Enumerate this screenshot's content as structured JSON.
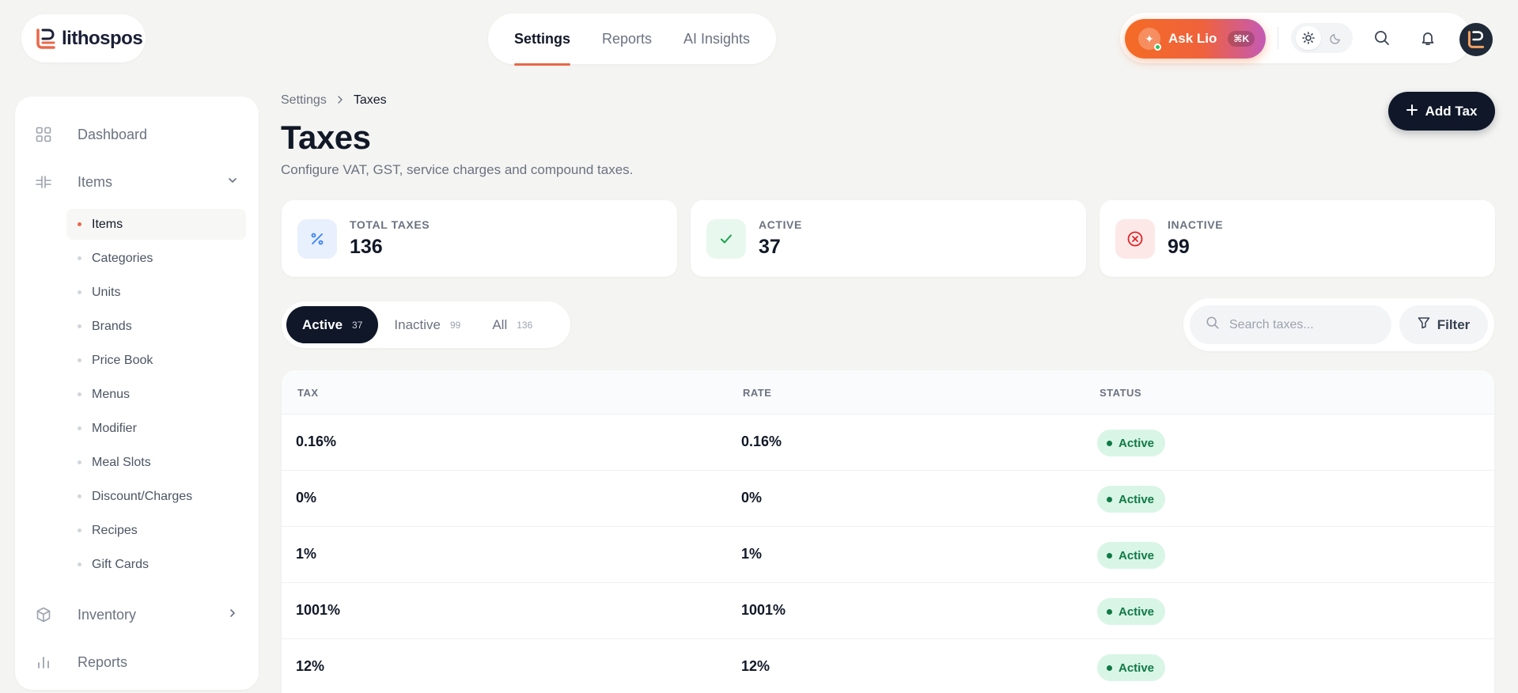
{
  "brand": {
    "name": "lithospos"
  },
  "topnav": [
    {
      "label": "Settings",
      "active": true
    },
    {
      "label": "Reports",
      "active": false
    },
    {
      "label": "AI Insights",
      "active": false
    }
  ],
  "header": {
    "ask_label": "Ask Lio",
    "ask_shortcut": "⌘K"
  },
  "sidebar": {
    "groups": [
      {
        "label": "Dashboard",
        "icon": "grid-icon"
      },
      {
        "label": "Items",
        "icon": "items-icon",
        "expanded": true
      },
      {
        "label": "Inventory",
        "icon": "box-icon"
      },
      {
        "label": "Reports",
        "icon": "bar-chart-icon"
      }
    ],
    "items_sub": [
      {
        "label": "Items",
        "active": true
      },
      {
        "label": "Categories"
      },
      {
        "label": "Units"
      },
      {
        "label": "Brands"
      },
      {
        "label": "Price Book"
      },
      {
        "label": "Menus"
      },
      {
        "label": "Modifier"
      },
      {
        "label": "Meal Slots"
      },
      {
        "label": "Discount/Charges"
      },
      {
        "label": "Recipes"
      },
      {
        "label": "Gift Cards"
      }
    ]
  },
  "breadcrumb": {
    "parent": "Settings",
    "current": "Taxes"
  },
  "page": {
    "title": "Taxes",
    "subtitle": "Configure VAT, GST, service charges and compound taxes.",
    "add_button": "Add Tax"
  },
  "stats": [
    {
      "label": "TOTAL TAXES",
      "value": "136",
      "color": "#3b82f6"
    },
    {
      "label": "ACTIVE",
      "value": "37",
      "color": "#16a34a"
    },
    {
      "label": "INACTIVE",
      "value": "99",
      "color": "#dc2626"
    }
  ],
  "tabs": [
    {
      "label": "Active",
      "count": "37",
      "active": true
    },
    {
      "label": "Inactive",
      "count": "99",
      "active": false
    },
    {
      "label": "All",
      "count": "136",
      "active": false
    }
  ],
  "search": {
    "placeholder": "Search taxes..."
  },
  "filter_label": "Filter",
  "table": {
    "columns": [
      "TAX",
      "RATE",
      "STATUS"
    ],
    "rows": [
      {
        "tax": "0.16%",
        "rate": "0.16%",
        "status": "Active"
      },
      {
        "tax": "0%",
        "rate": "0%",
        "status": "Active"
      },
      {
        "tax": "1%",
        "rate": "1%",
        "status": "Active"
      },
      {
        "tax": "1001%",
        "rate": "1001%",
        "status": "Active"
      },
      {
        "tax": "12%",
        "rate": "12%",
        "status": "Active"
      }
    ]
  },
  "colors": {
    "accent": "#e8694a",
    "dark": "#0f1729",
    "success_bg": "#d9f5e6",
    "success_fg": "#0f7a45"
  }
}
